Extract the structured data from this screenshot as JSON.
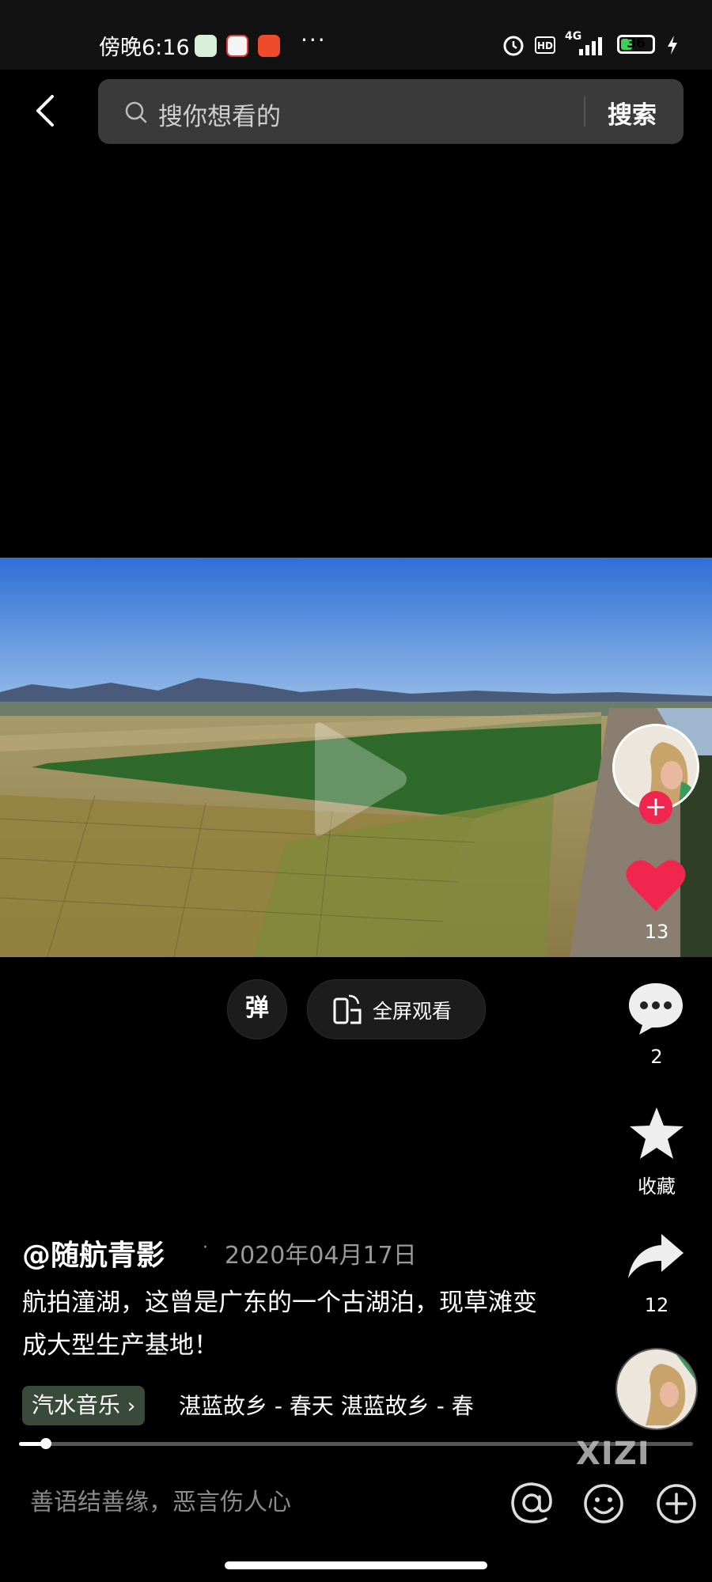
{
  "status_bar": {
    "time": "傍晚6:16",
    "network": "4G",
    "hd_label": "HD",
    "battery": "36",
    "battery_level": 0.36,
    "more": "···"
  },
  "search": {
    "placeholder": "搜你想看的",
    "button": "搜索"
  },
  "video": {
    "like_count": "13",
    "comment_count": "2",
    "favorite_label": "收藏",
    "share_count": "12",
    "danmu_label": "弹",
    "fullscreen_label": "全屏观看",
    "progress": 0.04
  },
  "post": {
    "author": "@随航青影",
    "separator": "·",
    "date": "2020年04月17日",
    "description": "航拍潼湖，这曾是广东的一个古湖泊，现草滩变成大型生产基地！",
    "music_tag": "汽水音乐",
    "music_tag_chevron": "›",
    "track": "湛蓝故乡 - 春天    湛蓝故乡 - 春"
  },
  "watermark": "XIZI",
  "comment_bar": {
    "placeholder": "善语结善缘，恶言伤人心"
  },
  "colors": {
    "background": "#000000",
    "like": "#f0264e",
    "follow": "#f0264e",
    "battery": "#3ecf5a"
  }
}
